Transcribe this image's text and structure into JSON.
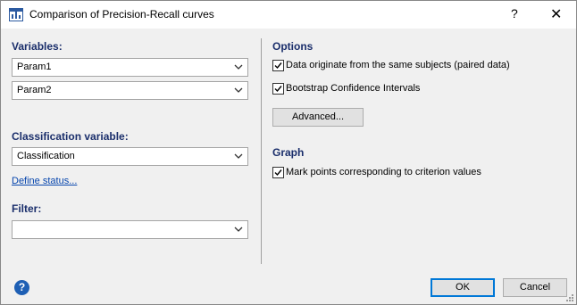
{
  "window": {
    "title": "Comparison of Precision-Recall curves",
    "help_label": "?",
    "close_label": "✕"
  },
  "left": {
    "variables_label": "Variables:",
    "variable1": "Param1",
    "variable2": "Param2",
    "classification_label": "Classification variable:",
    "classification_value": "Classification",
    "define_status_link": "Define status...",
    "filter_label": "Filter:",
    "filter_value": ""
  },
  "right": {
    "options_label": "Options",
    "paired_data": {
      "label": "Data originate from the same subjects (paired data)",
      "checked": true
    },
    "bootstrap": {
      "label": "Bootstrap Confidence Intervals",
      "checked": true
    },
    "advanced_button": "Advanced...",
    "graph_label": "Graph",
    "mark_points": {
      "label": "Mark points corresponding to criterion values",
      "checked": true
    }
  },
  "footer": {
    "help_icon_glyph": "?",
    "ok_label": "OK",
    "cancel_label": "Cancel"
  },
  "colors": {
    "section_heading": "#1a2e6b",
    "link": "#0645ad",
    "default_button_border": "#0078d7",
    "help_icon": "#1e5fb4"
  }
}
